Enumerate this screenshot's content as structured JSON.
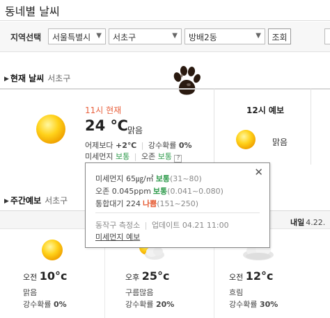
{
  "header": {
    "title": "동네별 날씨"
  },
  "region": {
    "label": "지역선택",
    "city": "서울특별시",
    "district": "서초구",
    "neighborhood": "방배2동",
    "search_label": "조회"
  },
  "current": {
    "section_title": "현재 날씨",
    "location": "서초구",
    "time_label": "11시 현재",
    "temperature": "24 ℃",
    "condition": "맑음",
    "yesterday_label": "어제보다",
    "yesterday_diff": "+2℃",
    "rain_label": "강수확률",
    "rain_value": "0%",
    "dust_label": "미세먼지",
    "dust_status": "보통",
    "ozone_label": "오존",
    "ozone_status": "보통",
    "help": "?"
  },
  "forecast12": {
    "title": "12시 예보",
    "condition": "맑음"
  },
  "weekly": {
    "section_title": "주간예보",
    "location": "서초구",
    "tomorrow_label": "내일",
    "tomorrow_date": "4.22.",
    "days": [
      {
        "period": "오전",
        "temp": "10°c",
        "condition": "맑음",
        "rain_label": "강수확률",
        "rain": "0%"
      },
      {
        "period": "오후",
        "temp": "25°c",
        "condition": "구름많음",
        "rain_label": "강수확률",
        "rain": "20%"
      },
      {
        "period": "오전",
        "temp": "12°c",
        "condition": "흐림",
        "rain_label": "강수확률",
        "rain": "30%"
      }
    ]
  },
  "popup": {
    "pm10_label": "미세먼지 65㎍/㎥",
    "pm10_status": "보통",
    "pm10_range": "(31~80)",
    "ozone_label": "오존 0.045ppm",
    "ozone_status": "보통",
    "ozone_range": "(0.041~0.080)",
    "cai_label": "통합대기 224",
    "cai_status": "나쁨",
    "cai_range": "(151~250)",
    "station": "동작구 측정소",
    "updated": "업데이트 04.21 11:00",
    "link": "미세먼지 예보",
    "close": "✕"
  },
  "colors": {
    "accent": "#e8603c",
    "good": "#2f9b4c",
    "bad": "#e4572e"
  },
  "icons": [
    "sun-icon",
    "partly-cloudy-icon",
    "cloudy-icon",
    "paw-icon",
    "close-icon",
    "chevron-down-icon"
  ]
}
